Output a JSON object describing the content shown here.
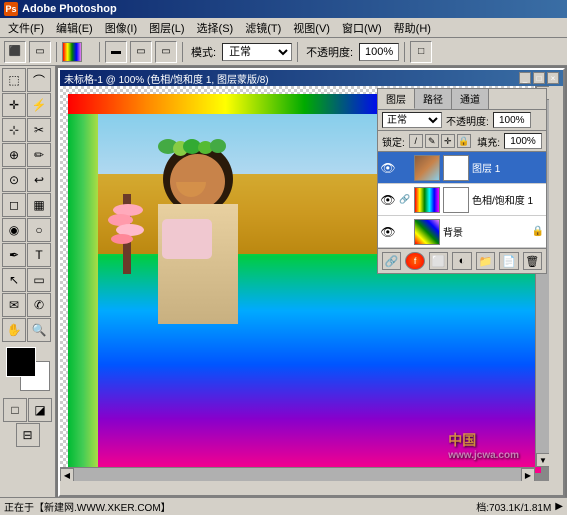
{
  "app": {
    "title": "Adobe Photoshop",
    "icon_label": "PS"
  },
  "menubar": {
    "items": [
      {
        "label": "文件(F)"
      },
      {
        "label": "编辑(E)"
      },
      {
        "label": "图像(I)"
      },
      {
        "label": "图层(L)"
      },
      {
        "label": "选择(S)"
      },
      {
        "label": "滤镜(T)"
      },
      {
        "label": "视图(V)"
      },
      {
        "label": "窗口(W)"
      },
      {
        "label": "帮助(H)"
      }
    ]
  },
  "toolbar": {
    "mode_label": "模式:",
    "mode_value": "正常",
    "opacity_label": "不透明度:",
    "opacity_value": "100%"
  },
  "canvas": {
    "title": "未标格-1 @ 100% (色相/饱和度 1, 图层蒙版/8)",
    "watermark1": "中国",
    "watermark2": "www.jcwa.com"
  },
  "layers_panel": {
    "tabs": [
      "图层",
      "路径",
      "通道"
    ],
    "active_tab": "图层",
    "blend_mode": "正常",
    "opacity_label": "不透明度:",
    "opacity_value": "100%",
    "lock_label": "锁定:",
    "fill_label": "填充:",
    "fill_value": "100%",
    "layers": [
      {
        "name": "图层 1",
        "visible": true,
        "type": "normal",
        "has_mask": true
      },
      {
        "name": "色相/饱和度 1",
        "visible": true,
        "type": "adjustment",
        "has_link": true
      },
      {
        "name": "背景",
        "visible": true,
        "type": "background",
        "locked": true
      }
    ],
    "bottom_buttons": [
      "🔗",
      "🎨",
      "📁",
      "🗑",
      "✨",
      "🗑"
    ]
  },
  "status_bar": {
    "text": "正在于【新建网.WWW.XKER.COM】",
    "size_info": "档:703.1K/1.81M",
    "arrow": "▶"
  },
  "colors": {
    "titlebar_start": "#0a246a",
    "titlebar_end": "#3a6ea5",
    "accent": "#316ac5"
  }
}
